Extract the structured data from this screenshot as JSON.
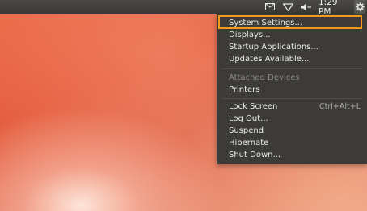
{
  "panel": {
    "clock": "1:29 PM",
    "indicators": [
      "mail-icon",
      "wifi-icon",
      "volume-icon",
      "gear-icon"
    ]
  },
  "session_menu": {
    "items": [
      {
        "label": "System Settings...",
        "enabled": true,
        "highlighted": true
      },
      {
        "label": "Displays...",
        "enabled": true
      },
      {
        "label": "Startup Applications...",
        "enabled": true
      },
      {
        "label": "Updates Available...",
        "enabled": true
      },
      {
        "label": "Attached Devices",
        "enabled": false
      },
      {
        "label": "Printers",
        "enabled": true
      },
      {
        "label": "Lock Screen",
        "shortcut": "Ctrl+Alt+L",
        "enabled": true
      },
      {
        "label": "Log Out...",
        "enabled": true
      },
      {
        "label": "Suspend",
        "enabled": true
      },
      {
        "label": "Hibernate",
        "enabled": true
      },
      {
        "label": "Shut Down...",
        "enabled": true
      }
    ]
  },
  "colors": {
    "panel": "#3c3b37",
    "highlight_border": "#f29a1d",
    "desktop_accent": "#e25a3a"
  }
}
